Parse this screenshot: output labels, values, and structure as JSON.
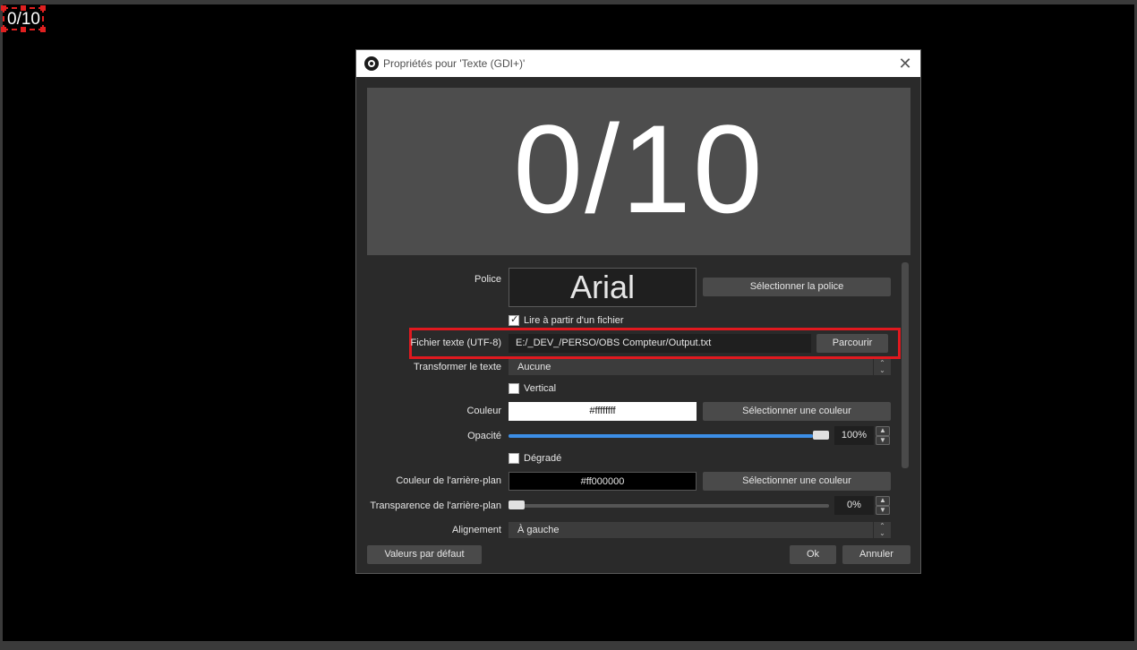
{
  "canvas": {
    "source_text": "0/10"
  },
  "dialog": {
    "title": "Propriétés pour 'Texte (GDI+)'",
    "close_icon": "close-icon",
    "preview_text": "0/10",
    "font": {
      "label": "Police",
      "value": "Arial",
      "button": "Sélectionner la police"
    },
    "read_from_file": {
      "label": "Lire à partir d'un fichier",
      "checked": true
    },
    "text_file": {
      "label": "Fichier texte (UTF-8)",
      "value": "E:/_DEV_/PERSO/OBS Compteur/Output.txt",
      "button": "Parcourir"
    },
    "transform": {
      "label": "Transformer le texte",
      "value": "Aucune"
    },
    "vertical": {
      "label": "Vertical",
      "checked": false
    },
    "color": {
      "label": "Couleur",
      "value": "#ffffffff",
      "button": "Sélectionner une couleur"
    },
    "opacity": {
      "label": "Opacité",
      "value": "100%",
      "level": 1.0
    },
    "gradient": {
      "label": "Dégradé",
      "checked": false
    },
    "bg_color": {
      "label": "Couleur de l'arrière-plan",
      "value": "#ff000000",
      "button": "Sélectionner une couleur"
    },
    "bg_transparency": {
      "label": "Transparence de l'arrière-plan",
      "value": "0%",
      "level": 0.0
    },
    "alignment": {
      "label": "Alignement",
      "value": "À gauche"
    },
    "defaults_button": "Valeurs par défaut",
    "ok_button": "Ok",
    "cancel_button": "Annuler"
  },
  "colors": {
    "highlight": "#e0191f",
    "slider_fill": "#3c8ee6",
    "dialog_bg": "#2a2a2a"
  }
}
